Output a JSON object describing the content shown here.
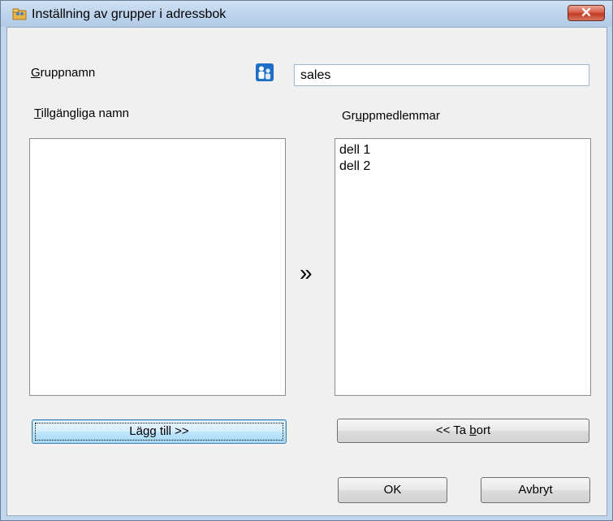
{
  "window": {
    "title": "Inställning av grupper i adressbok",
    "close_glyph": "✕",
    "app_icon": "folder-people-icon"
  },
  "group_name": {
    "label_first": "G",
    "label_rest": "ruppnamn",
    "icon": "group-people-icon",
    "value": "sales"
  },
  "available": {
    "label_first": "T",
    "label_rest": "illgängliga namn",
    "items": []
  },
  "members": {
    "label_pre": "Gr",
    "label_ul": "u",
    "label_post": "ppmedlemmar",
    "items": [
      "dell 1",
      "dell 2"
    ]
  },
  "arrow_glyph": "»",
  "buttons": {
    "add": "Lägg till >>",
    "remove_pre": "<< Ta ",
    "remove_ul": "b",
    "remove_post": "ort",
    "ok": "OK",
    "cancel": "Avbryt"
  },
  "colors": {
    "accent": "#1e6fc6",
    "close": "#c13a23",
    "title_bar": "#bcd3ec"
  }
}
